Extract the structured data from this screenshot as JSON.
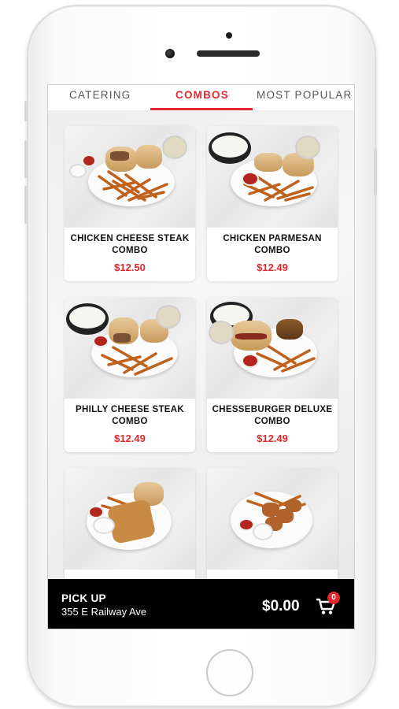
{
  "tabs": [
    {
      "label": "CATERING",
      "active": false
    },
    {
      "label": "COMBOS",
      "active": true
    },
    {
      "label": "MOST POPULAR",
      "active": false
    }
  ],
  "items": [
    {
      "name": "CHICKEN CHEESE STEAK COMBO",
      "price": "$12.50"
    },
    {
      "name": "CHICKEN PARMESAN COMBO",
      "price": "$12.49"
    },
    {
      "name": "PHILLY CHEESE STEAK COMBO",
      "price": "$12.49"
    },
    {
      "name": "CHESSEBURGER DELUXE COMBO",
      "price": "$12.49"
    },
    {
      "name": "",
      "price": ""
    },
    {
      "name": "",
      "price": ""
    }
  ],
  "bottom_bar": {
    "mode": "PICK UP",
    "address": "355 E Railway Ave",
    "total": "$0.00",
    "cart_count": "0"
  },
  "colors": {
    "accent": "#e0282e",
    "bar": "#000000"
  },
  "icons": {
    "cart": "shopping-cart-icon"
  }
}
